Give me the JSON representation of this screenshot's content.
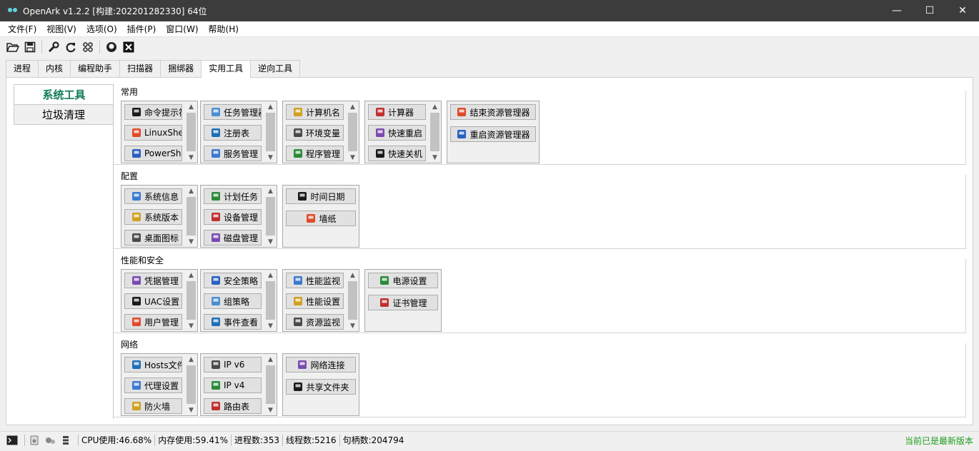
{
  "window": {
    "title": "OpenArk v1.2.2  [构建:202201282330]  64位",
    "minimize": "—",
    "maximize": "☐",
    "close": "✕"
  },
  "menu": [
    "文件(F)",
    "视图(V)",
    "选项(O)",
    "插件(P)",
    "窗口(W)",
    "帮助(H)"
  ],
  "toolbar": [
    "open-icon",
    "save-icon",
    "wrench-icon",
    "refresh-icon",
    "grid-icon",
    "github-icon",
    "exit-icon"
  ],
  "tabs": [
    "进程",
    "内核",
    "编程助手",
    "扫描器",
    "捆绑器",
    "实用工具",
    "逆向工具"
  ],
  "active_tab": "实用工具",
  "side_nav": [
    "系统工具",
    "垃圾清理"
  ],
  "groups": [
    {
      "title": "常用",
      "panels": [
        {
          "buttons": [
            {
              "label": "命令提示符",
              "icon": "cmd-icon"
            },
            {
              "label": "LinuxShell",
              "icon": "ubuntu-icon"
            },
            {
              "label": "PowerShell",
              "icon": "powershell-icon"
            }
          ],
          "scroll": true
        },
        {
          "buttons": [
            {
              "label": "任务管理器",
              "icon": "taskmgr-icon"
            },
            {
              "label": "注册表",
              "icon": "regedit-icon"
            },
            {
              "label": "服务管理",
              "icon": "services-icon"
            }
          ],
          "scroll": true
        },
        {
          "buttons": [
            {
              "label": "计算机名",
              "icon": "computer-name-icon"
            },
            {
              "label": "环境变量",
              "icon": "env-var-icon"
            },
            {
              "label": "程序管理",
              "icon": "programs-icon"
            }
          ],
          "scroll": true
        },
        {
          "buttons": [
            {
              "label": "计算器",
              "icon": "calculator-icon"
            },
            {
              "label": "快速重启",
              "icon": "restart-icon"
            },
            {
              "label": "快速关机",
              "icon": "shutdown-icon"
            }
          ],
          "scroll": true
        },
        {
          "buttons": [
            {
              "label": "结束资源管理器",
              "icon": "explorer-stop-icon"
            },
            {
              "label": "重启资源管理器",
              "icon": "explorer-restart-icon"
            }
          ],
          "scroll": false
        }
      ]
    },
    {
      "title": "配置",
      "panels": [
        {
          "buttons": [
            {
              "label": "系统信息",
              "icon": "sysinfo-icon"
            },
            {
              "label": "系统版本",
              "icon": "winver-icon"
            },
            {
              "label": "桌面图标",
              "icon": "desktop-icon"
            }
          ],
          "scroll": true
        },
        {
          "buttons": [
            {
              "label": "计划任务",
              "icon": "schedule-icon"
            },
            {
              "label": "设备管理",
              "icon": "device-icon"
            },
            {
              "label": "磁盘管理",
              "icon": "disk-icon"
            }
          ],
          "scroll": true
        },
        {
          "buttons": [
            {
              "label": "时间日期",
              "icon": "datetime-icon"
            },
            {
              "label": "墙纸",
              "icon": "wallpaper-icon"
            }
          ],
          "scroll": false
        }
      ]
    },
    {
      "title": "性能和安全",
      "panels": [
        {
          "buttons": [
            {
              "label": "凭据管理",
              "icon": "credential-icon"
            },
            {
              "label": "UAC设置",
              "icon": "uac-icon"
            },
            {
              "label": "用户管理",
              "icon": "users-icon"
            }
          ],
          "scroll": true
        },
        {
          "buttons": [
            {
              "label": "安全策略",
              "icon": "secpol-icon"
            },
            {
              "label": "组策略",
              "icon": "gpedit-icon"
            },
            {
              "label": "事件查看",
              "icon": "eventvwr-icon"
            }
          ],
          "scroll": true
        },
        {
          "buttons": [
            {
              "label": "性能监视",
              "icon": "perfmon-icon"
            },
            {
              "label": "性能设置",
              "icon": "perf-settings-icon"
            },
            {
              "label": "资源监视",
              "icon": "resmon-icon"
            }
          ],
          "scroll": true
        },
        {
          "buttons": [
            {
              "label": "电源设置",
              "icon": "power-icon"
            },
            {
              "label": "证书管理",
              "icon": "cert-icon"
            }
          ],
          "scroll": false
        }
      ]
    },
    {
      "title": "网络",
      "panels": [
        {
          "buttons": [
            {
              "label": "Hosts文件",
              "icon": "hosts-icon"
            },
            {
              "label": "代理设置",
              "icon": "proxy-icon"
            },
            {
              "label": "防火墙",
              "icon": "firewall-icon"
            }
          ],
          "scroll": true
        },
        {
          "buttons": [
            {
              "label": "IP v6",
              "icon": "ipv6-icon"
            },
            {
              "label": "IP v4",
              "icon": "ipv4-icon"
            },
            {
              "label": "路由表",
              "icon": "route-icon"
            }
          ],
          "scroll": true
        },
        {
          "buttons": [
            {
              "label": "网络连接",
              "icon": "network-icon"
            },
            {
              "label": "共享文件夹",
              "icon": "share-icon"
            }
          ],
          "scroll": false
        }
      ]
    }
  ],
  "status": {
    "cpu": "CPU使用:46.68%",
    "mem": "内存使用:59.41%",
    "proc": "进程数:353",
    "threads": "线程数:5216",
    "handles": "句柄数:204794",
    "update": "当前已是最新版本"
  },
  "colors": {
    "accent": "#0f7c58",
    "titlebar": "#3c3c3c",
    "update_text": "#1e9c1e"
  }
}
